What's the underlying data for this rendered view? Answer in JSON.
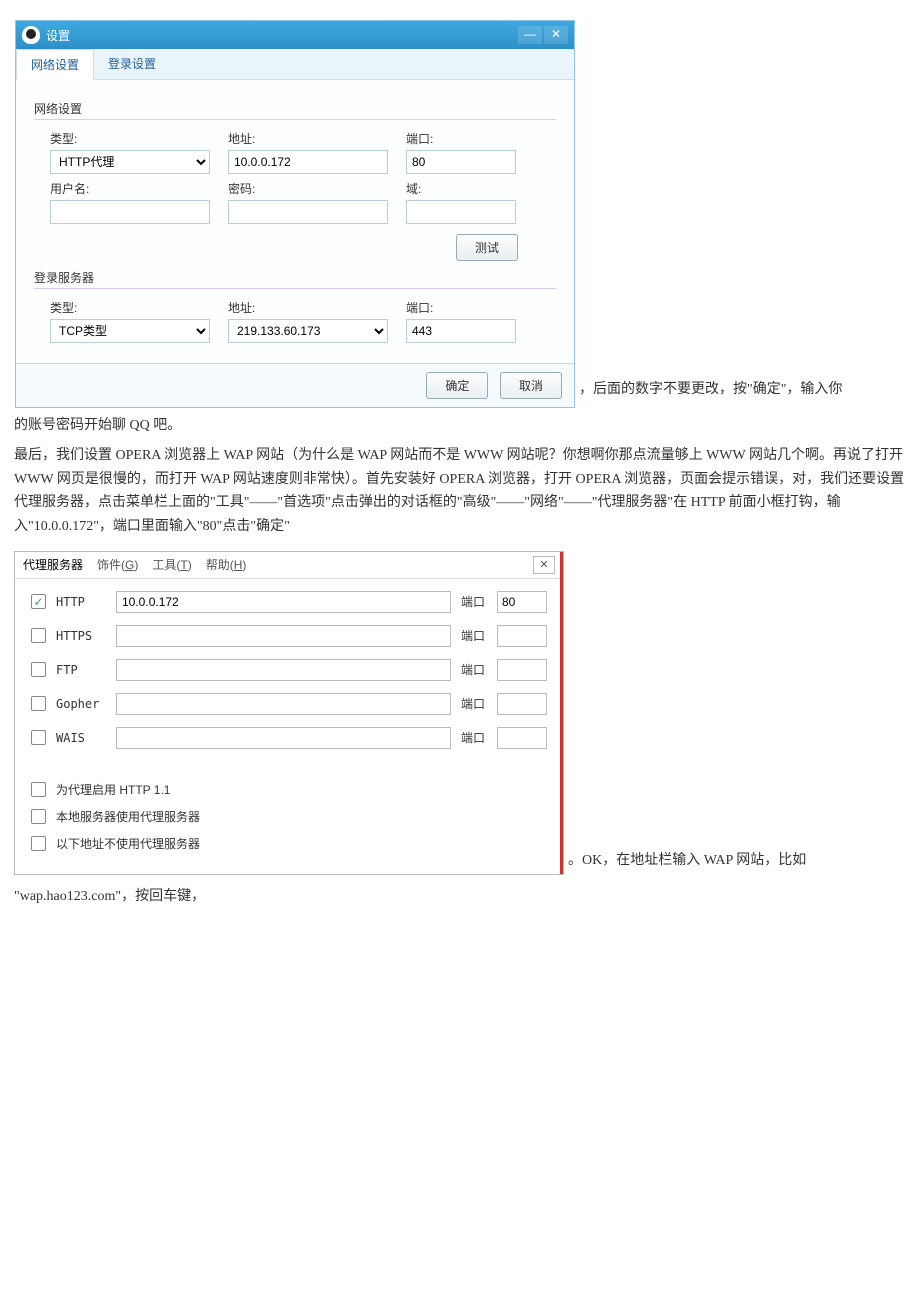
{
  "qq": {
    "title": "设置",
    "tabs": {
      "network": "网络设置",
      "login": "登录设置"
    },
    "network_group": "网络设置",
    "labels": {
      "type": "类型:",
      "addr": "地址:",
      "port": "端口:",
      "user": "用户名:",
      "pass": "密码:",
      "domain": "域:"
    },
    "proxy": {
      "type": "HTTP代理",
      "addr": "10.0.0.172",
      "port": "80",
      "user": "",
      "pass": "",
      "domain": ""
    },
    "test_btn": "测试",
    "login_group": "登录服务器",
    "login": {
      "type": "TCP类型",
      "addr": "219.133.60.173",
      "port": "443"
    },
    "ok": "确定",
    "cancel": "取消"
  },
  "para1a": "，后面的数字不要更改，按\"确定\"，输入你",
  "para1b": "的账号密码开始聊 QQ 吧。",
  "para2": "最后，我们设置 OPERA 浏览器上 WAP 网站（为什么是 WAP 网站而不是 WWW 网站呢？你想啊你那点流量够上 WWW 网站几个啊。再说了打开 WWW 网页是很慢的，而打开 WAP 网站速度则非常快）。首先安装好 OPERA 浏览器，打开 OPERA 浏览器，页面会提示错误，对，我们还要设置代理服务器，点击菜单栏上面的\"工具\"——\"首选项\"点击弹出的对话框的\"高级\"——\"网络\"——\"代理服务器\"在 HTTP 前面小框打钩，输入\"10.0.0.172\"，端口里面输入\"80\"点击\"确定\"",
  "opera": {
    "title": "代理服务器",
    "menu": {
      "decor": "饰件(G)",
      "tools": "工具(T)",
      "help": "帮助(H)"
    },
    "port_label": "端口",
    "rows": [
      {
        "proto": "HTTP",
        "checked": true,
        "addr": "10.0.0.172",
        "port": "80"
      },
      {
        "proto": "HTTPS",
        "checked": false,
        "addr": "",
        "port": ""
      },
      {
        "proto": "FTP",
        "checked": false,
        "addr": "",
        "port": ""
      },
      {
        "proto": "Gopher",
        "checked": false,
        "addr": "",
        "port": ""
      },
      {
        "proto": "WAIS",
        "checked": false,
        "addr": "",
        "port": ""
      }
    ],
    "opts": {
      "http11": "为代理启用 HTTP 1.1",
      "local": "本地服务器使用代理服务器",
      "bypass": "以下地址不使用代理服务器"
    }
  },
  "para3a": "。OK，在地址栏输入 WAP 网站，比如",
  "para3b": "\"wap.hao123.com\"，按回车键，"
}
